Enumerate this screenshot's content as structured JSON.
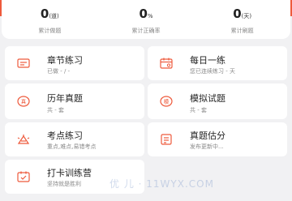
{
  "colors": {
    "accent": "#ee5a3c",
    "card": "#ffffff",
    "bg": "#f1f1f3"
  },
  "stats": [
    {
      "value": "0",
      "unit": "(道)",
      "label": "累计做题"
    },
    {
      "value": "0",
      "unit": "%",
      "label": "累计正确率"
    },
    {
      "value": "0",
      "unit": "(天)",
      "label": "累计刷题"
    }
  ],
  "cards": {
    "chapter": {
      "title": "章节练习",
      "sub": "已做 - / -",
      "icon": "chapter-icon"
    },
    "daily": {
      "title": "每日一练",
      "sub": "您已连续练习 - 天",
      "icon": "calendar-icon"
    },
    "past": {
      "title": "历年真题",
      "sub": "共 - 套",
      "icon": "past-exam-icon"
    },
    "mock": {
      "title": "模拟试题",
      "sub": "共 - 套",
      "icon": "mock-exam-icon"
    },
    "points": {
      "title": "考点练习",
      "sub": "重点,难点,易错考点",
      "icon": "key-points-icon"
    },
    "estimate": {
      "title": "真题估分",
      "sub": "发布更新中...",
      "icon": "score-estimate-icon"
    },
    "checkin": {
      "title": "打卡训练营",
      "sub": "坚持就是胜利",
      "icon": "checkin-icon"
    }
  },
  "watermark": "优 儿 · 11WYX.COM"
}
